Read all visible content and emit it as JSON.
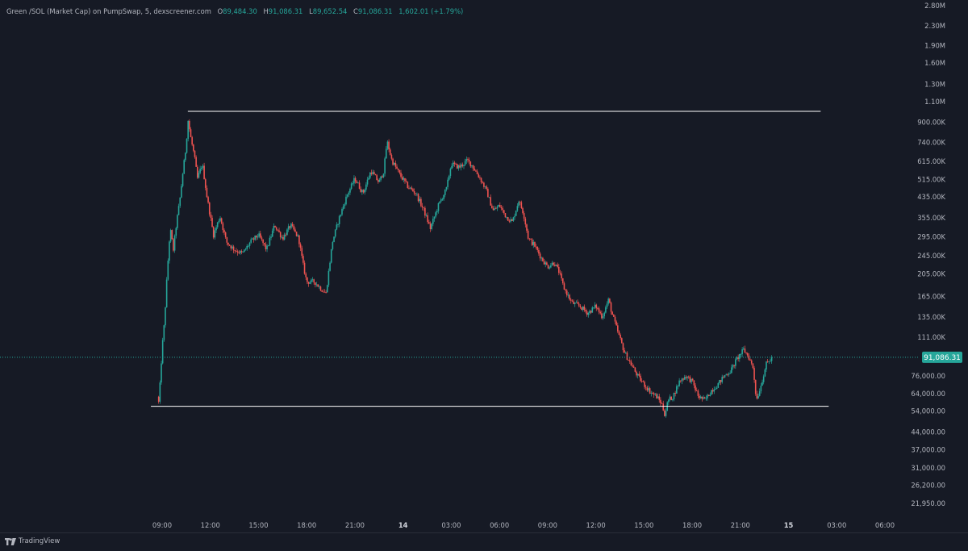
{
  "legend": {
    "symbol": "Green /SOL (Market Cap) on PumpSwap, 5, dexscreener.com",
    "o_label": "O",
    "o_value": "89,484.30",
    "h_label": "H",
    "h_value": "91,086.31",
    "l_label": "L",
    "l_value": "89,652.54",
    "c_label": "C",
    "c_value": "91,086.31",
    "change": "1,602.01 (+1.79%)"
  },
  "branding": {
    "logo_text": "TradingView"
  },
  "colors": {
    "background": "#161a25",
    "up": "#26a69a",
    "down": "#ef5350",
    "text": "#b2b5be",
    "price_tag_bg": "#26a69a",
    "lines": "#ffffff"
  },
  "chart_data": {
    "type": "candlestick",
    "y_scale": "log",
    "grid": false,
    "ylim": [
      20000,
      2900000
    ],
    "y_ticks": [
      {
        "label": "2.80M",
        "value": 2800000
      },
      {
        "label": "2.30M",
        "value": 2300000
      },
      {
        "label": "1.90M",
        "value": 1900000
      },
      {
        "label": "1.60M",
        "value": 1600000
      },
      {
        "label": "1.30M",
        "value": 1300000
      },
      {
        "label": "1.10M",
        "value": 1100000
      },
      {
        "label": "900.00K",
        "value": 900000
      },
      {
        "label": "740.00K",
        "value": 740000
      },
      {
        "label": "615.00K",
        "value": 615000
      },
      {
        "label": "515.00K",
        "value": 515000
      },
      {
        "label": "435.00K",
        "value": 435000
      },
      {
        "label": "355.00K",
        "value": 355000
      },
      {
        "label": "295.00K",
        "value": 295000
      },
      {
        "label": "245.00K",
        "value": 245000
      },
      {
        "label": "205.00K",
        "value": 205000
      },
      {
        "label": "165.00K",
        "value": 165000
      },
      {
        "label": "135.00K",
        "value": 135000
      },
      {
        "label": "111.00K",
        "value": 111000
      },
      {
        "label": "76,000.00",
        "value": 76000
      },
      {
        "label": "64,000.00",
        "value": 64000
      },
      {
        "label": "54,000.00",
        "value": 54000
      },
      {
        "label": "44,000.00",
        "value": 44000
      },
      {
        "label": "37,000.00",
        "value": 37000
      },
      {
        "label": "31,000.00",
        "value": 31000
      },
      {
        "label": "26,200.00",
        "value": 26200
      },
      {
        "label": "21,950.00",
        "value": 21950
      }
    ],
    "x_ticks": [
      "09:00",
      "12:00",
      "15:00",
      "18:00",
      "21:00",
      "14",
      "03:00",
      "06:00",
      "09:00",
      "12:00",
      "15:00",
      "18:00",
      "21:00",
      "15",
      "03:00",
      "06:00"
    ],
    "x_ticks_bold": [
      "14",
      "15"
    ],
    "x_tick_hours": [
      9,
      12,
      15,
      18,
      21,
      24,
      27,
      30,
      33,
      36,
      39,
      42,
      45,
      48,
      51,
      54
    ],
    "x_range_hours": [
      5.1,
      57.1
    ],
    "current_price": 91086.31,
    "current_price_label": "91,086.31",
    "horizontal_lines": [
      {
        "name": "resistance",
        "value": 1000000,
        "from_hours": 10.6,
        "to_hours": 50.0
      },
      {
        "name": "support",
        "value": 56500,
        "from_hours": 8.3,
        "to_hours": 50.5
      }
    ],
    "anchors": [
      [
        8.7,
        62000
      ],
      [
        8.8,
        58000
      ],
      [
        9.0,
        100000
      ],
      [
        9.15,
        130000
      ],
      [
        9.3,
        200000
      ],
      [
        9.5,
        320000
      ],
      [
        9.7,
        260000
      ],
      [
        9.9,
        340000
      ],
      [
        10.1,
        420000
      ],
      [
        10.3,
        560000
      ],
      [
        10.5,
        720000
      ],
      [
        10.6,
        930000
      ],
      [
        10.8,
        760000
      ],
      [
        11.0,
        650000
      ],
      [
        11.2,
        520000
      ],
      [
        11.5,
        600000
      ],
      [
        11.8,
        430000
      ],
      [
        12.2,
        300000
      ],
      [
        12.6,
        360000
      ],
      [
        13.0,
        280000
      ],
      [
        13.5,
        260000
      ],
      [
        14.0,
        250000
      ],
      [
        14.5,
        280000
      ],
      [
        15.0,
        300000
      ],
      [
        15.5,
        260000
      ],
      [
        16.0,
        330000
      ],
      [
        16.5,
        290000
      ],
      [
        17.0,
        330000
      ],
      [
        17.5,
        290000
      ],
      [
        17.8,
        220000
      ],
      [
        18.0,
        190000
      ],
      [
        18.5,
        190000
      ],
      [
        18.8,
        180000
      ],
      [
        19.2,
        170000
      ],
      [
        19.6,
        280000
      ],
      [
        20.0,
        350000
      ],
      [
        20.5,
        440000
      ],
      [
        21.0,
        520000
      ],
      [
        21.5,
        450000
      ],
      [
        22.0,
        560000
      ],
      [
        22.5,
        500000
      ],
      [
        22.8,
        560000
      ],
      [
        23.0,
        750000
      ],
      [
        23.3,
        620000
      ],
      [
        23.8,
        540000
      ],
      [
        24.3,
        480000
      ],
      [
        24.8,
        450000
      ],
      [
        25.3,
        380000
      ],
      [
        25.7,
        320000
      ],
      [
        26.2,
        400000
      ],
      [
        26.7,
        470000
      ],
      [
        27.0,
        600000
      ],
      [
        27.5,
        580000
      ],
      [
        28.0,
        620000
      ],
      [
        28.3,
        590000
      ],
      [
        28.8,
        520000
      ],
      [
        29.2,
        460000
      ],
      [
        29.6,
        380000
      ],
      [
        30.0,
        400000
      ],
      [
        30.4,
        360000
      ],
      [
        30.8,
        340000
      ],
      [
        31.2,
        420000
      ],
      [
        31.5,
        370000
      ],
      [
        31.8,
        290000
      ],
      [
        32.2,
        270000
      ],
      [
        32.6,
        240000
      ],
      [
        33.0,
        220000
      ],
      [
        33.4,
        230000
      ],
      [
        33.7,
        210000
      ],
      [
        34.0,
        180000
      ],
      [
        34.5,
        155000
      ],
      [
        35.0,
        150000
      ],
      [
        35.5,
        140000
      ],
      [
        36.0,
        150000
      ],
      [
        36.4,
        135000
      ],
      [
        36.8,
        160000
      ],
      [
        37.0,
        140000
      ],
      [
        37.4,
        115000
      ],
      [
        37.8,
        95000
      ],
      [
        38.2,
        85000
      ],
      [
        38.6,
        76000
      ],
      [
        39.0,
        70000
      ],
      [
        39.4,
        65000
      ],
      [
        39.8,
        62000
      ],
      [
        40.1,
        58000
      ],
      [
        40.3,
        52000
      ],
      [
        40.5,
        60000
      ],
      [
        40.8,
        62000
      ],
      [
        41.2,
        72000
      ],
      [
        41.6,
        76000
      ],
      [
        42.0,
        72000
      ],
      [
        42.4,
        62000
      ],
      [
        42.8,
        60000
      ],
      [
        43.2,
        66000
      ],
      [
        43.6,
        70000
      ],
      [
        44.0,
        76000
      ],
      [
        44.4,
        80000
      ],
      [
        44.8,
        90000
      ],
      [
        45.2,
        98000
      ],
      [
        45.5,
        92000
      ],
      [
        45.8,
        82000
      ],
      [
        46.0,
        60000
      ],
      [
        46.3,
        70000
      ],
      [
        46.6,
        85000
      ],
      [
        47.0,
        91086
      ]
    ]
  }
}
